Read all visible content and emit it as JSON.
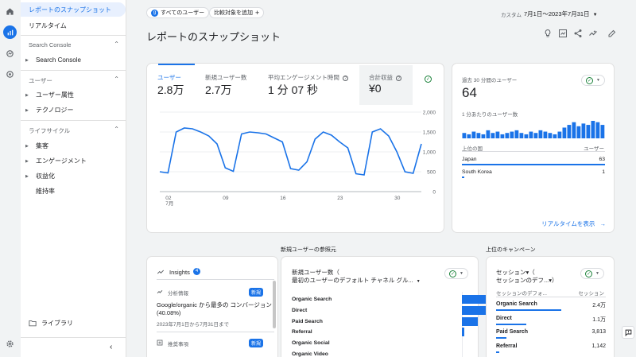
{
  "nav": {
    "items": [
      {
        "label": "レポートのスナップショット"
      },
      {
        "label": "リアルタイム"
      }
    ],
    "search_console_section": "Search Console",
    "search_console_item": "Search Console",
    "user_section": "ユーザー",
    "user_items": [
      "ユーザー属性",
      "テクノロジー"
    ],
    "lifecycle_section": "ライフサイクル",
    "lifecycle_items": [
      "集客",
      "エンゲージメント",
      "収益化",
      "維持率"
    ],
    "library": "ライブラリ"
  },
  "header": {
    "segment": "すべてのユーザー",
    "compare": "比較対象を追加",
    "custom_label": "カスタム",
    "date_range": "7月1日～2023年7月31日",
    "page_title": "レポートのスナップショット"
  },
  "metrics": [
    {
      "label": "ユーザー",
      "value": "2.8万"
    },
    {
      "label": "新規ユーザー数",
      "value": "2.7万"
    },
    {
      "label": "平均エンゲージメント時間",
      "value": "1 分 07 秒"
    },
    {
      "label": "合計収益",
      "value": "¥0"
    }
  ],
  "chart_data": {
    "type": "line",
    "x_tick_labels": [
      "02\n7月",
      "09",
      "16",
      "23",
      "30"
    ],
    "y_tick_labels": [
      "2,000",
      "1,500",
      "1,000",
      "500",
      "0"
    ],
    "ylim": [
      0,
      2000
    ],
    "series": [
      {
        "values": [
          500,
          470,
          1500,
          1600,
          1580,
          1500,
          1400,
          1200,
          600,
          510,
          1450,
          1500,
          1480,
          1450,
          1350,
          1250,
          580,
          540,
          750,
          1320,
          1500,
          1420,
          1250,
          1100,
          450,
          420,
          1500,
          1580,
          1400,
          1000,
          500,
          460,
          1200
        ]
      }
    ],
    "color": "#1a73e8"
  },
  "realtime": {
    "label": "過去 30 分間のユーザー",
    "value": "64",
    "per_minute_label": "1 分あたりのユーザー数",
    "per_minute_bars": [
      4,
      3,
      5,
      4,
      3,
      6,
      4,
      5,
      3,
      4,
      5,
      6,
      4,
      3,
      5,
      4,
      6,
      5,
      4,
      3,
      5,
      8,
      10,
      12,
      9,
      11,
      10,
      13,
      12,
      10
    ],
    "country_header": "上位の国",
    "users_header": "ユーザー",
    "countries": [
      {
        "name": "Japan",
        "value": "63",
        "fraction": 1.0
      },
      {
        "name": "South Korea",
        "value": "1",
        "fraction": 0.016
      }
    ],
    "link": "リアルタイムを表示",
    "bar_color": "#1a73e8"
  },
  "sections": {
    "new_users_source": "新規ユーザーの参照元",
    "top_campaigns": "上位のキャンペーン"
  },
  "insights": {
    "title": "Insights",
    "badge": "4",
    "item1_type": "分析情報",
    "item1_badge": "新規",
    "item1_line1": "Google/organic から最多の コンバージョン (40.08%)",
    "item1_date": "2023年7月1日から7月31日まで",
    "item2_type": "推奨事項",
    "item2_badge": "新規"
  },
  "source_card": {
    "title_line1": "新規ユーザー数（",
    "title_line2": "最初のユーザーのデフォルト チャネル グル...",
    "bars": [
      {
        "label": "Organic Search",
        "fraction": 1.0
      },
      {
        "label": "Direct",
        "fraction": 0.4
      },
      {
        "label": "Paid Search",
        "fraction": 0.15
      },
      {
        "label": "Referral",
        "fraction": 0.02
      },
      {
        "label": "Organic Social",
        "fraction": 0.0
      },
      {
        "label": "Organic Video",
        "fraction": 0.0
      }
    ],
    "bar_color": "#1a73e8"
  },
  "campaign_card": {
    "title_line1": "セッション▾（",
    "title_line2": "セッションのデフ...▾）",
    "col1": "セッションのデフォ...",
    "col2": "セッション",
    "rows": [
      {
        "name": "Organic Search",
        "value": "2.4万",
        "fraction": 1.0
      },
      {
        "name": "Direct",
        "value": "1.1万",
        "fraction": 0.46
      },
      {
        "name": "Paid Search",
        "value": "3,813",
        "fraction": 0.16
      },
      {
        "name": "Referral",
        "value": "1,142",
        "fraction": 0.05
      }
    ]
  }
}
